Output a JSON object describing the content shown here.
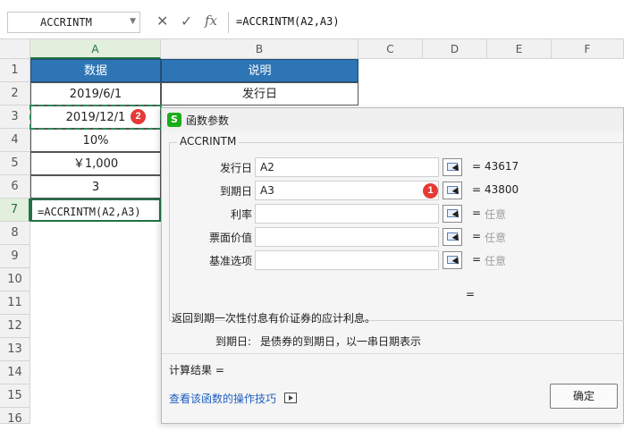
{
  "formula_bar": {
    "name_box": "ACCRINTM",
    "cancel_icon": "✕",
    "enter_icon": "✓",
    "fx_label": "fx",
    "formula": "=ACCRINTM(A2,A3)"
  },
  "columns": [
    "A",
    "B",
    "C",
    "D",
    "E",
    "F"
  ],
  "rows": [
    "1",
    "2",
    "3",
    "4",
    "5",
    "6",
    "7",
    "8",
    "9",
    "10",
    "11",
    "12",
    "13",
    "14",
    "15",
    "16"
  ],
  "table": {
    "header": [
      "数据",
      "说明"
    ],
    "cells_a": [
      "2019/6/1",
      "2019/12/1",
      "10%",
      "￥1,000",
      "3"
    ],
    "cell_b2": "发行日",
    "formula_cell": "=ACCRINTM(A2,A3)"
  },
  "badges": {
    "cell_badge": "2",
    "arg_badge": "1"
  },
  "dialog": {
    "title": "函数参数",
    "logo_glyph": "S",
    "function_name": "ACCRINTM",
    "args": [
      {
        "label": "发行日",
        "value": "A2",
        "eq": "=",
        "result": "43617"
      },
      {
        "label": "到期日",
        "value": "A3",
        "eq": "=",
        "result": "43800"
      },
      {
        "label": "利率",
        "value": "",
        "eq": "=",
        "result": "任意"
      },
      {
        "label": "票面价值",
        "value": "",
        "eq": "=",
        "result": "任意"
      },
      {
        "label": "基准选项",
        "value": "",
        "eq": "=",
        "result": "任意"
      }
    ],
    "result_eq": "=",
    "description": "返回到期一次性付息有价证券的应计利息。",
    "arg_desc_name": "到期日:",
    "arg_desc_text": "是债券的到期日，以一串日期表示",
    "calc_result": "计算结果 =",
    "help_link": "查看该函数的操作技巧",
    "ok_button": "确定"
  },
  "colors": {
    "header_blue": "#2e75b6",
    "selection_green": "#217346",
    "badge_red": "#e53935",
    "link_blue": "#1f5fbf"
  }
}
